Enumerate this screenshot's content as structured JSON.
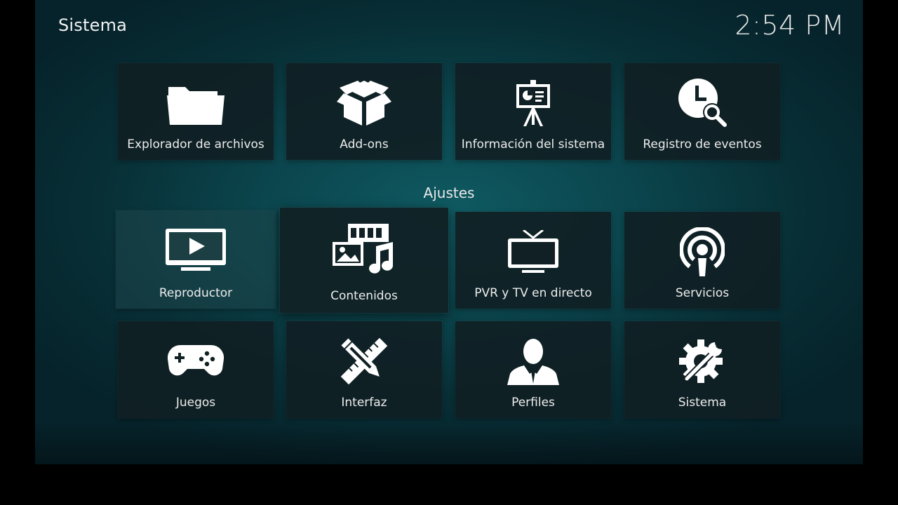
{
  "header": {
    "title": "Sistema",
    "clock": "2:54 PM"
  },
  "section": {
    "label": "Ajustes"
  },
  "top_row": [
    {
      "label": "Explorador de archivos",
      "icon": "folder-icon"
    },
    {
      "label": "Add-ons",
      "icon": "box-icon"
    },
    {
      "label": "Información del sistema",
      "icon": "presentation-icon"
    },
    {
      "label": "Registro de eventos",
      "icon": "clock-search-icon"
    }
  ],
  "settings_row1": [
    {
      "label": "Reproductor",
      "icon": "tv-play-icon",
      "state": "active"
    },
    {
      "label": "Contenidos",
      "icon": "media-library-icon",
      "state": "focused"
    },
    {
      "label": "PVR y TV en directo",
      "icon": "tv-antenna-icon"
    },
    {
      "label": "Servicios",
      "icon": "broadcast-icon"
    }
  ],
  "settings_row2": [
    {
      "label": "Juegos",
      "icon": "gamepad-icon"
    },
    {
      "label": "Interfaz",
      "icon": "pencil-ruler-icon"
    },
    {
      "label": "Perfiles",
      "icon": "user-icon"
    },
    {
      "label": "Sistema",
      "icon": "gear-wrench-icon"
    }
  ],
  "colors": {
    "background": "#0b444c",
    "tile": "#102024",
    "text": "#ededed"
  }
}
